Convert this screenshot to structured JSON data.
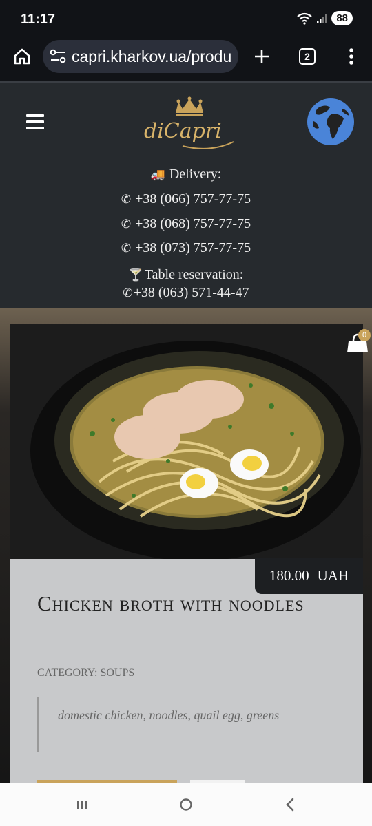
{
  "status_bar": {
    "time": "11:17",
    "battery": "88"
  },
  "browser": {
    "url": "capri.kharkov.ua/produ",
    "tab_count": "2"
  },
  "header": {
    "logo_text": "diCapri",
    "delivery_label": "Delivery:",
    "phones": [
      "+38 (066) 757-77-75",
      "+38 (068) 757-77-75",
      "+38 (073) 757-77-75"
    ],
    "reservation_label": "Table reservation:",
    "reservation_phone": "+38 (063) 571-44-47"
  },
  "product": {
    "cart_count": "0",
    "price": "180.00",
    "currency": "UAH",
    "title": "Chicken broth with noodles",
    "category_label": "CATEGORY:",
    "category_value": "SOUPS",
    "ingredients": "domestic chicken, noodles, quail egg, greens"
  },
  "icons": {
    "home": "home-icon",
    "site-info": "site-info-icon",
    "new-tab": "plus-icon",
    "menu": "more-vertical-icon",
    "hamburger": "hamburger-icon",
    "globe": "globe-icon",
    "truck": "truck-icon",
    "phone": "phone-icon",
    "cocktail": "cocktail-icon",
    "cart": "shopping-bag-icon"
  },
  "colors": {
    "header_bg": "#262a2e",
    "accent_gold": "#c9a35b",
    "card_bg": "#c8c9cb",
    "globe_blue": "#4a84d8"
  }
}
